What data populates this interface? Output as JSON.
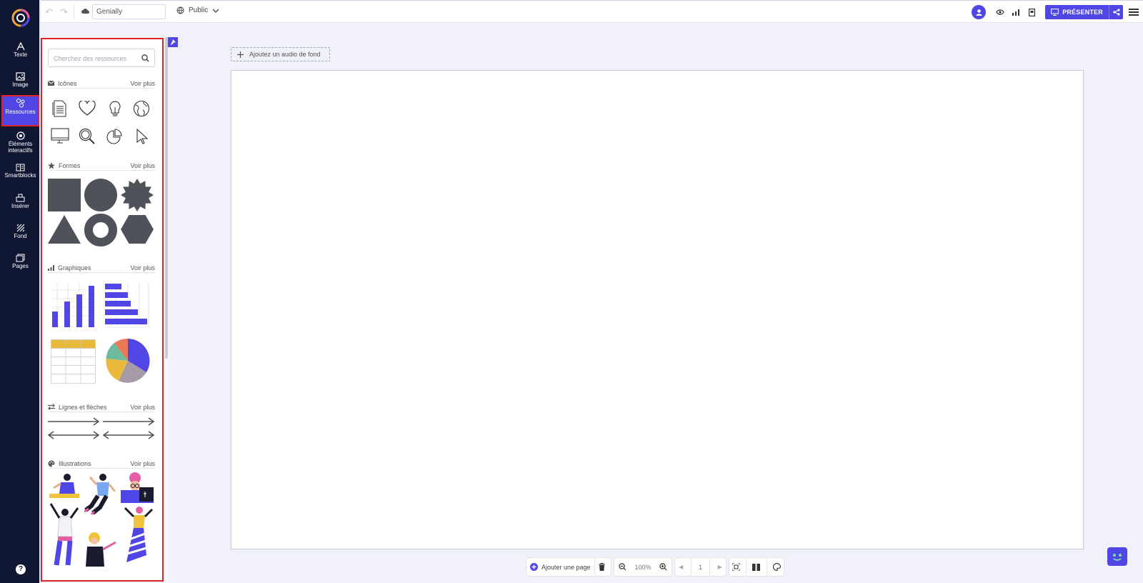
{
  "rail": {
    "items": [
      {
        "label": "Texte"
      },
      {
        "label": "Image"
      },
      {
        "label": "Ressources"
      },
      {
        "label": "Éléments interactifs"
      },
      {
        "label": "Smartblocks"
      },
      {
        "label": "Insérer"
      },
      {
        "label": "Fond"
      },
      {
        "label": "Pages"
      }
    ],
    "help_label": "?"
  },
  "topbar": {
    "project_name": "Genially",
    "visibility": "Public",
    "present_label": "PRÉSENTER"
  },
  "panel": {
    "search_placeholder": "Cherchez des ressources",
    "sections": [
      {
        "title": "Icônes",
        "more": "Voir plus"
      },
      {
        "title": "Formes",
        "more": "Voir plus"
      },
      {
        "title": "Graphiques",
        "more": "Voir plus"
      },
      {
        "title": "Lignes et flèches",
        "more": "Voir plus"
      },
      {
        "title": "Illustrations",
        "more": "Voir plus"
      }
    ]
  },
  "canvas": {
    "audio_label": "Ajoutez un audio de fond"
  },
  "bottombar": {
    "add_page_label": "Ajouter une page",
    "zoom": "100%",
    "page_number": "1"
  },
  "colors": {
    "accent": "#4f46e5",
    "rail_bg": "#0f1733",
    "highlight": "#e02424",
    "shape_gray": "#4f5259",
    "chart_yellow": "#e8b93a"
  }
}
